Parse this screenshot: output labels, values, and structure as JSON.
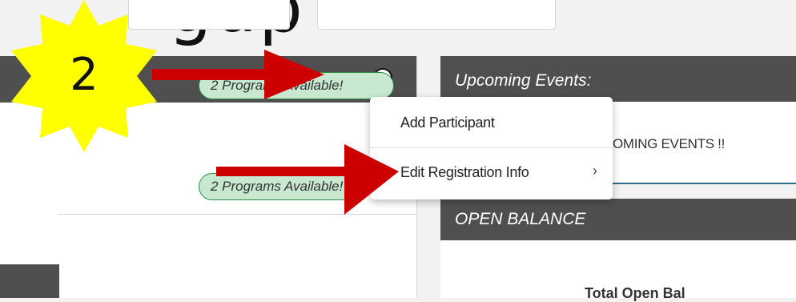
{
  "page": {
    "title_fragment": "gup"
  },
  "left": {
    "programs_badge_1": "2 Programs Available!",
    "programs_badge_2": "2 Programs Available!"
  },
  "menu": {
    "item_add": "Add Participant",
    "item_edit": "Edit Registration Info",
    "chevron": "›"
  },
  "right": {
    "upcoming_header": "Upcoming Events:",
    "no_events": "UPCOMING EVENTS !!",
    "balance_header": "OPEN BALANCE",
    "total_fragment": "Total Open Bal"
  },
  "annotation": {
    "step": "2"
  },
  "colors": {
    "header_bg": "#4f4f4f",
    "pill_bg": "#c8e8cf",
    "arrow": "#cc0000",
    "badge": "#ffff00"
  },
  "icons": {
    "menu_button": "ellipsis-circle-icon"
  }
}
